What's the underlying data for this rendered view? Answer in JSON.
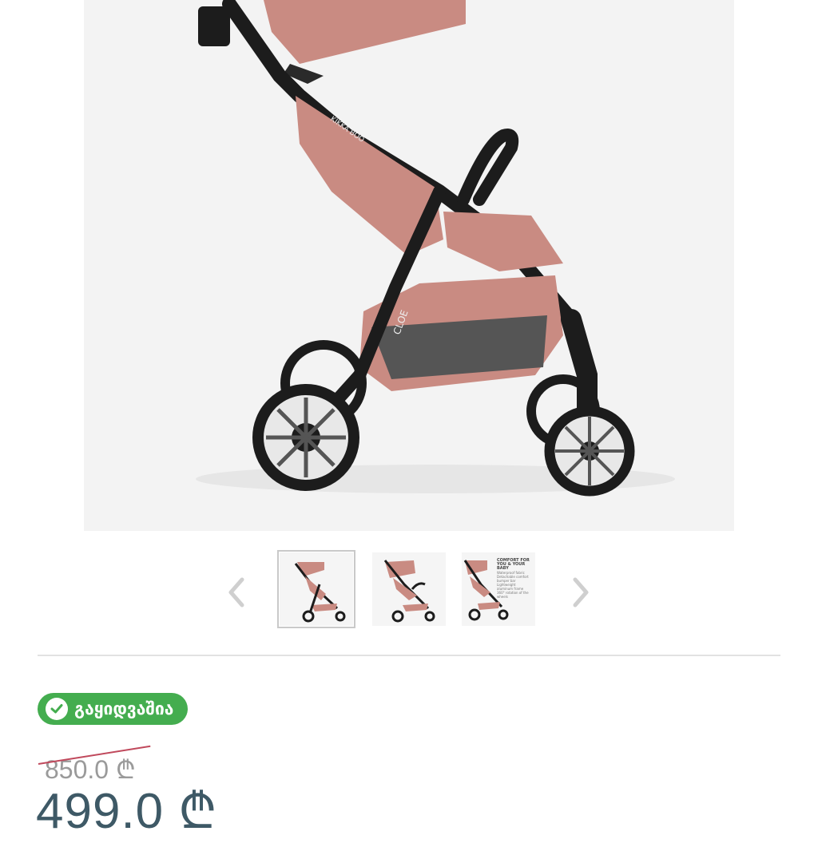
{
  "product_image": {
    "brand_label": "KIKKA BOO",
    "model_label": "CLOE",
    "colors": {
      "fabric": "#c98b82",
      "frame": "#1c1c1c",
      "background": "#f3f3f3"
    }
  },
  "gallery": {
    "prev_icon": "chevron-left-icon",
    "next_icon": "chevron-right-icon",
    "thumb3_title": "COMFORT FOR YOU & YOUR BABY",
    "thumb3_lines": [
      "Waterproof fabric",
      "Detachable comfort bumper bar",
      "Lightweight aluminum frame",
      "360° rotation of the wheels"
    ]
  },
  "status": {
    "icon": "check-circle-icon",
    "label": "გაყიდვაშია",
    "color": "#44ad4f"
  },
  "price": {
    "old": "850.0 ₾",
    "new": "499.0 ₾",
    "new_color": "#3e5966"
  }
}
